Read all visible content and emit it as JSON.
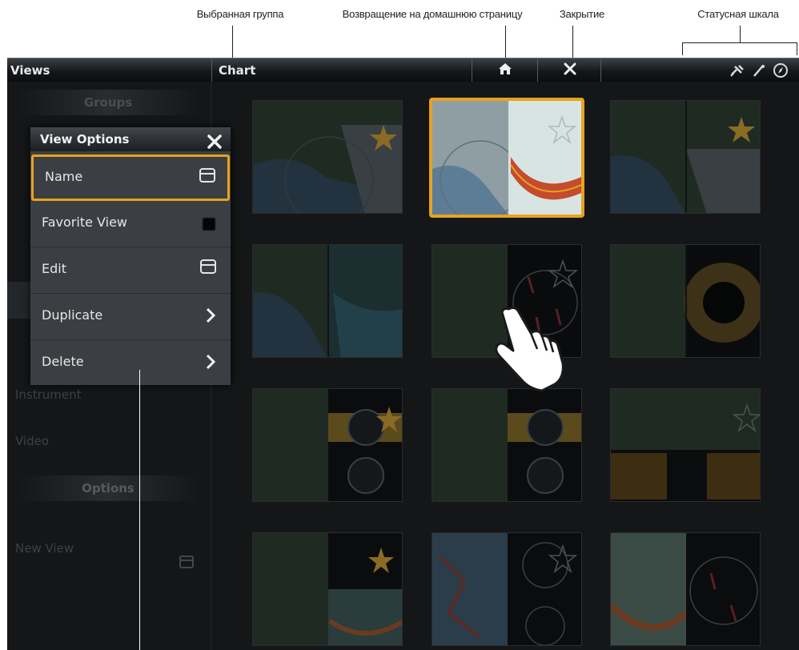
{
  "callouts": {
    "selected_group": "Выбранная группа",
    "home": "Возвращение на домашнюю страницу",
    "close": "Закрытие",
    "status_bar": "Статусная шкала"
  },
  "topbar": {
    "views_title": "Views",
    "group_title": "Chart",
    "home_icon": "home-icon",
    "close_icon": "close-icon",
    "status_icons": [
      "satellite-icon",
      "antenna-icon",
      "compass-icon"
    ]
  },
  "sidebar": {
    "groups_header": "Groups",
    "items": [
      "Instrument",
      "Video"
    ],
    "options_header": "Options",
    "new_view_label": "New View"
  },
  "dialog": {
    "title": "View Options",
    "close_icon": "close-icon",
    "options": [
      {
        "label": "Name",
        "icon": "keyboard-icon"
      },
      {
        "label": "Favorite View",
        "icon": "checkbox-icon"
      },
      {
        "label": "Edit",
        "icon": "keyboard-icon"
      },
      {
        "label": "Duplicate",
        "icon": "chevron-right-icon"
      },
      {
        "label": "Delete",
        "icon": "chevron-right-icon"
      }
    ]
  },
  "colors": {
    "accent": "#e8a21e",
    "background": "#0d0f11",
    "panel": "#3b3f43"
  },
  "overlay": {
    "touch_icon": "hand-pointer-icon"
  }
}
